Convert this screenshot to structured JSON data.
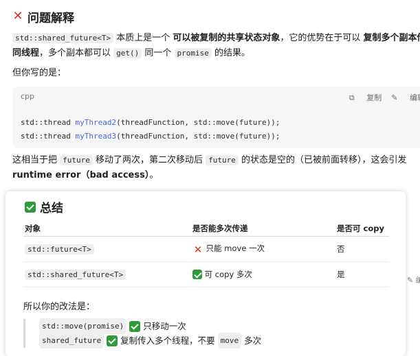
{
  "section1": {
    "title": "问题解释",
    "p1": {
      "code_type": "std::shared_future<T>",
      "t1": " 本质上是一个 ",
      "b1": "可以被复制的共享状态对象",
      "t2": "，它的优势在于可以 ",
      "b2": "复制多个副本传给",
      "b3": "同线程",
      "t3": "，多个副本都可以 ",
      "c_get": "get()",
      "t4": " 同一个 ",
      "c_promise": "promise",
      "t5": " 的结果。"
    },
    "p2": "但你写的是：",
    "code_block": {
      "language": "cpp",
      "copy_label": "复制",
      "edit_label": "编辑",
      "line1": {
        "prefix": "std::thread ",
        "fn": "myThread2",
        "rest": "(threadFunction, std::move(future));"
      },
      "line2": {
        "prefix": "std::thread ",
        "fn": "myThread3",
        "rest": "(threadFunction, std::move(future));"
      }
    },
    "p3": {
      "t1": "这相当于把 ",
      "c_future": "future",
      "t2": " 移动了两次，第二次移动后 ",
      "c_future2": "future",
      "t3": " 的状态是空的（已被前面转移），这会引发",
      "b1": "runtime error（bad access）",
      "t4": "。"
    }
  },
  "summary": {
    "title": "总结",
    "headers": [
      "对象",
      "是否能多次传递",
      "是否可 copy"
    ],
    "rows": [
      {
        "object": "std::future<T>",
        "icon": "cross-mark-icon",
        "transfer": "只能 move 一次",
        "copy": "否"
      },
      {
        "object": "std::shared_future<T>",
        "icon": "check-mark-icon",
        "transfer": "可 copy 多次",
        "copy": "是"
      }
    ],
    "conclusion": "所以你的改法是：",
    "quote": {
      "line1_code": "std::move(promise)",
      "line1_text": "只移动一次",
      "line2_code": "shared_future",
      "line2_text1": "复制传入多个线程，不要 ",
      "line2_code2": "move",
      "line2_text2": " 多次"
    }
  },
  "side": {
    "edit_label": "编"
  },
  "colors": {
    "accent_fn": "#4a6bd6",
    "check": "#2e9a3a",
    "cross": "#d0342c"
  }
}
